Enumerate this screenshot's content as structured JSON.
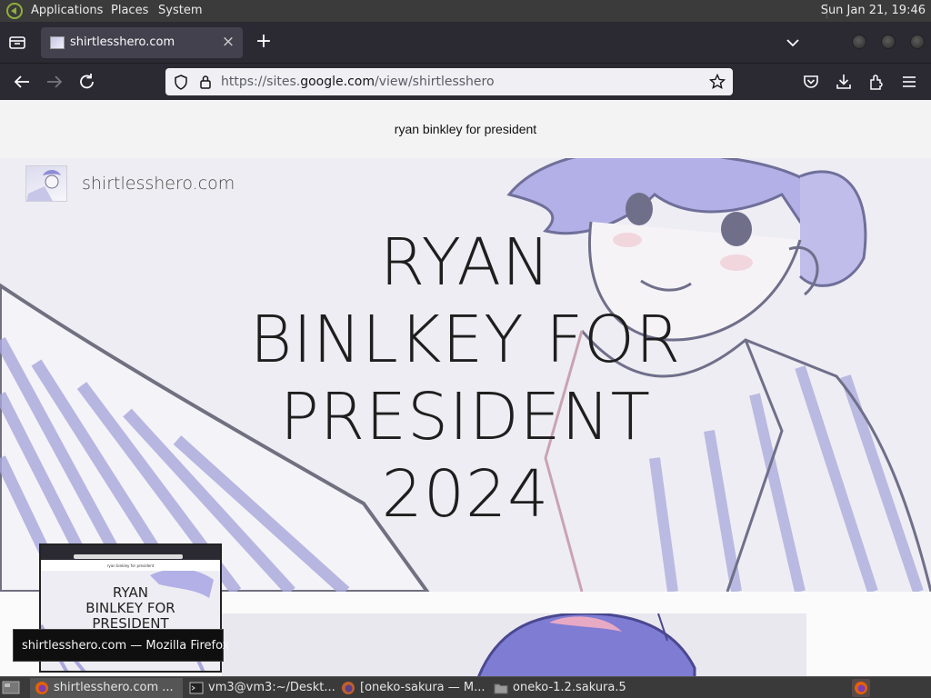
{
  "top_panel": {
    "menu": [
      "Applications",
      "Places",
      "System"
    ],
    "clock": "Sun Jan 21, 19:46"
  },
  "browser": {
    "tab": {
      "title": "shirtlesshero.com",
      "close_glyph": "×"
    },
    "new_tab_glyph": "+",
    "url": {
      "scheme": "https://sites.",
      "domain": "google.com",
      "path": "/view/shirtlesshero"
    }
  },
  "page": {
    "announcement": "ryan binkley for president",
    "site_name": "shirtlesshero.com",
    "hero_title_lines": [
      "RYAN",
      "BINLKEY FOR",
      "PRESIDENT",
      "2024"
    ]
  },
  "preview": {
    "announcement": "ryan binkley for president",
    "title_lines": [
      "RYAN",
      "BINLKEY FOR",
      "PRESIDENT"
    ]
  },
  "tooltip": "shirtlesshero.com — Mozilla Firefox",
  "taskbar": {
    "tasks": [
      {
        "label": "shirtlesshero.com ...",
        "icon": "firefox-icon"
      },
      {
        "label": "vm3@vm3:~/Deskt...",
        "icon": "terminal-icon"
      },
      {
        "label": "[oneko-sakura — M...",
        "icon": "firefox-icon"
      },
      {
        "label": "oneko-1.2.sakura.5",
        "icon": "folder-icon"
      }
    ]
  },
  "colors": {
    "panel": "#3b3b3b",
    "browser_chrome": "#2b2a33",
    "active_tab": "#42414d",
    "urlbar": "#f0f0f4",
    "hero_bg": "#eeedf3",
    "art_stripe": "#a9a8dc",
    "art_line": "#6f6f8a"
  }
}
